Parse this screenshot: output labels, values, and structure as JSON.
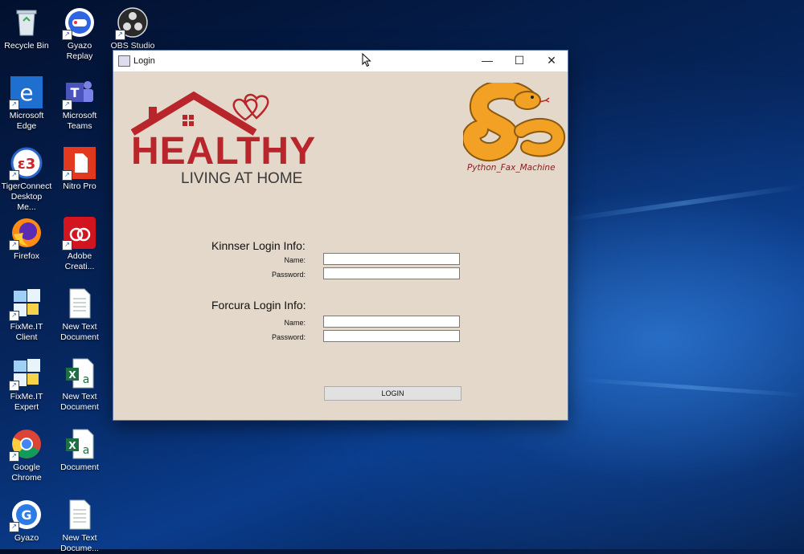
{
  "desktop": {
    "icons": [
      {
        "label": "Recycle Bin",
        "icon": "recycle-bin-icon"
      },
      {
        "label": "Gyazo Replay",
        "icon": "gyazo-replay-icon"
      },
      {
        "label": "OBS Studio",
        "icon": "obs-icon"
      },
      {
        "label": "Microsoft\nEdge",
        "icon": "edge-icon"
      },
      {
        "label": "Microsoft\nTeams",
        "icon": "teams-icon"
      },
      {
        "label": "TigerConnect\nDesktop Me...",
        "icon": "tigerconnect-icon"
      },
      {
        "label": "Nitro Pro",
        "icon": "nitro-icon"
      },
      {
        "label": "Firefox",
        "icon": "firefox-icon"
      },
      {
        "label": "Adobe\nCreati...",
        "icon": "adobe-cc-icon"
      },
      {
        "label": "FixMe.IT\nClient",
        "icon": "fixmeit-icon"
      },
      {
        "label": "New Text\nDocument",
        "icon": "text-document-icon"
      },
      {
        "label": "FixMe.IT\nExpert",
        "icon": "fixmeit-icon"
      },
      {
        "label": "New Text\nDocument",
        "icon": "excel-document-icon"
      },
      {
        "label": "Google\nChrome",
        "icon": "chrome-icon"
      },
      {
        "label": "Document",
        "icon": "excel-document-icon"
      },
      {
        "label": "Gyazo",
        "icon": "gyazo-icon"
      },
      {
        "label": "New Text\nDocume...",
        "icon": "text-document-icon"
      }
    ]
  },
  "window": {
    "title": "Login",
    "minimize": "—",
    "maximize": "☐",
    "close": "✕"
  },
  "logos": {
    "healthy_main": "HEALTHY",
    "healthy_sub": "LIVING AT HOME",
    "python_caption": "Python_Fax_Machine"
  },
  "kinnser": {
    "heading": "Kinnser Login Info:",
    "name_label": "Name:",
    "password_label": "Password:",
    "name_value": "",
    "password_value": ""
  },
  "forcura": {
    "heading": "Forcura Login Info:",
    "name_label": "Name:",
    "password_label": "Password:",
    "name_value": "",
    "password_value": ""
  },
  "login_button": "LOGIN",
  "colors": {
    "brand_red": "#b8262c",
    "window_bg": "#e3d8c9",
    "python_orange": "#f2a124"
  }
}
